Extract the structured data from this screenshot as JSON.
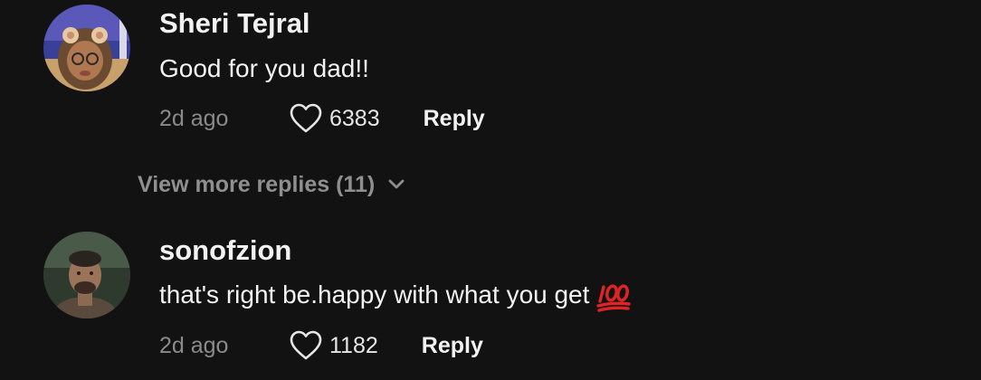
{
  "comments": [
    {
      "username": "Sheri Tejral",
      "text": "Good for you dad!!",
      "time": "2d ago",
      "likes": "6383",
      "reply_label": "Reply",
      "avatar": "girl-with-bear-ears-filter-avatar"
    },
    {
      "username": "sonofzion",
      "text": "that's right be.happy with what you get",
      "emoji": "hundred-points-emoji",
      "time": "2d ago",
      "likes": "1182",
      "reply_label": "Reply",
      "avatar": "man-portrait-avatar"
    }
  ],
  "view_more": {
    "label": "View more replies (11)",
    "icon": "chevron-down-icon"
  },
  "colors": {
    "background": "#121212",
    "username": "#f2f2f2",
    "secondary": "#8a8a8a",
    "emoji_red": "#e02424"
  }
}
